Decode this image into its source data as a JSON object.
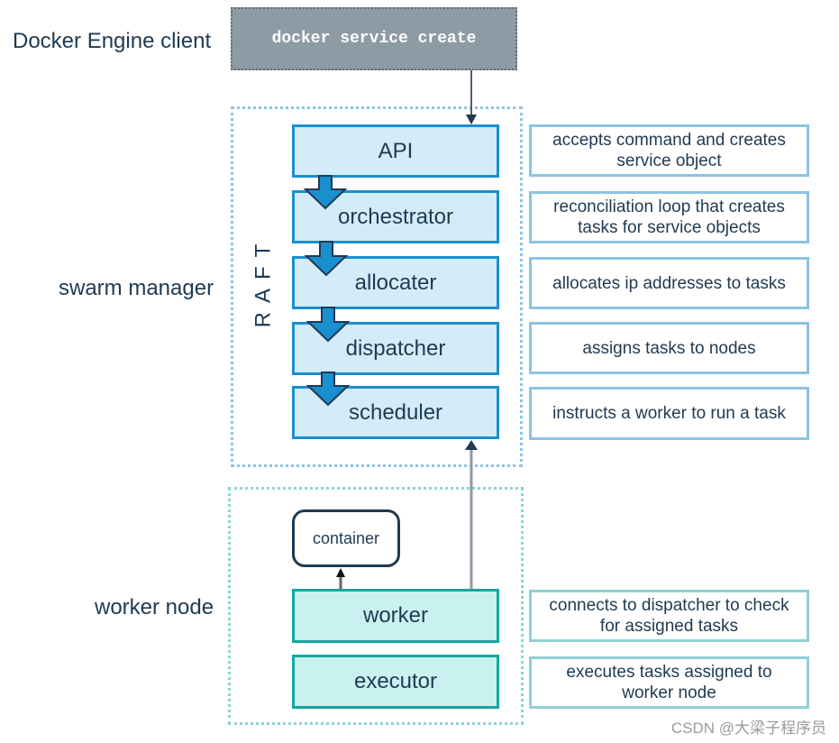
{
  "labels": {
    "client": "Docker Engine client",
    "manager": "swarm manager",
    "worker": "worker node",
    "raft": "RAFT"
  },
  "command": "docker service create",
  "manager_components": [
    {
      "name": "API",
      "description": "accepts command and creates service object"
    },
    {
      "name": "orchestrator",
      "description": "reconciliation loop that creates tasks for service objects"
    },
    {
      "name": "allocater",
      "description": "allocates ip addresses to tasks"
    },
    {
      "name": "dispatcher",
      "description": "assigns tasks to nodes"
    },
    {
      "name": "scheduler",
      "description": "instructs a worker to run a task"
    }
  ],
  "worker_components": [
    {
      "name": "worker",
      "description": "connects to dispatcher to check for assigned tasks"
    },
    {
      "name": "executor",
      "description": "executes tasks assigned to worker node"
    }
  ],
  "container_label": "container",
  "watermark": "CSDN @大梁子程序员",
  "colors": {
    "manager_accent": "#1a8fcf",
    "manager_fill": "#d3ecf9",
    "worker_accent": "#17a6a0",
    "worker_fill": "#c9f1ef",
    "cli_fill": "#8d9ba4",
    "text": "#1f3a52"
  }
}
